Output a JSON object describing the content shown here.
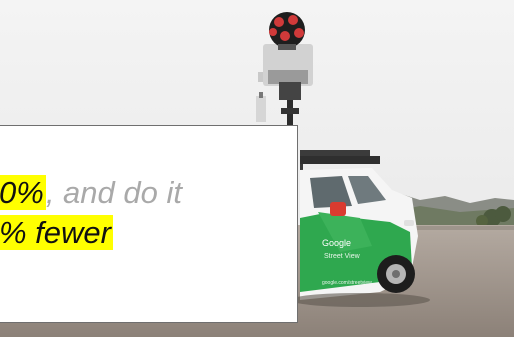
{
  "quote": {
    "line1_highlight": "0%",
    "line1_rest": ", and do it",
    "line2_highlight": "% fewer"
  },
  "photo": {
    "subject": "street-view-car",
    "car_brand_text": "Google",
    "car_product_text": "Street View",
    "car_url_text": "google.com/streetview"
  },
  "colors": {
    "highlight": "#ffff00",
    "muted_text": "#a9a9a9",
    "car_green": "#28a745",
    "sky": "#eeeeee"
  }
}
